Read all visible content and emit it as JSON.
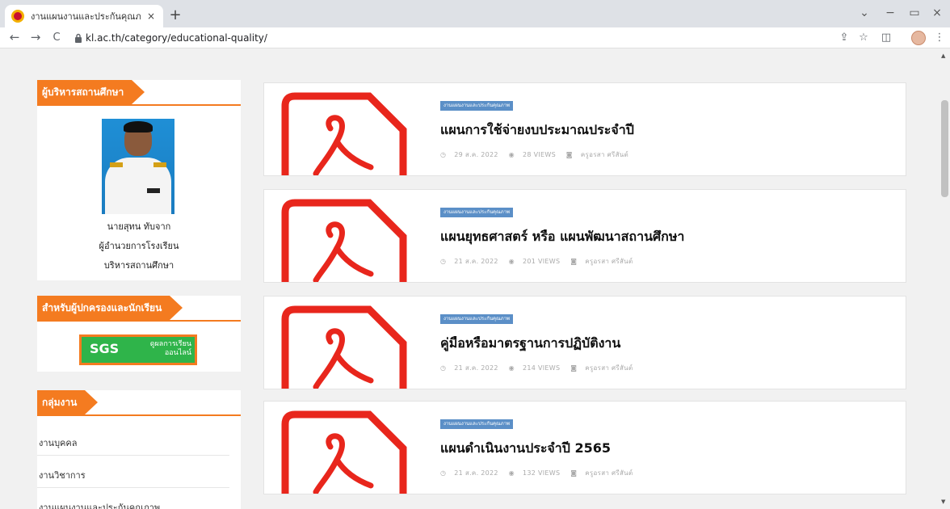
{
  "browser": {
    "tab_title": "งานแผนงานและประกันคุณภาพ – โรงเ",
    "tab_close": "×",
    "new_tab": "+",
    "url": "kl.ac.th/category/educational-quality/",
    "back": "←",
    "forward": "→",
    "reload": "C",
    "share": "⇪",
    "star": "☆",
    "sidepanel": "◫",
    "menu": "⋮",
    "minimize": "−",
    "restore": "▭",
    "close": "×",
    "tabsearch": "⌄"
  },
  "sidebar": {
    "admin_widget": {
      "title": "ผู้บริหารสถานศึกษา",
      "name": "นายสุทน ทับจาก",
      "position": "ผู้อำนวยการโรงเรียน",
      "role": "บริหารสถานศึกษา"
    },
    "parents_widget": {
      "title": "สำหรับผู้ปกครองและนักเรียน",
      "sgs_label": "SGS",
      "sgs_th_line1": "ดูผลการเรียน",
      "sgs_th_line2": "ออนไลน์"
    },
    "groups_widget": {
      "title": "กลุ่มงาน",
      "items": [
        "งานบุคคล",
        "งานวิชาการ",
        "งานแผนงานและประกันคุณภาพ"
      ]
    }
  },
  "posts": [
    {
      "category": "งานแผนงานและประกันคุณภาพ",
      "title": "แผนการใช้จ่ายงบประมาณประจำปี",
      "date": "29 ส.ค. 2022",
      "views": "28 VIEWS",
      "author": "ครูอรสา ศรีสันต์"
    },
    {
      "category": "งานแผนงานและประกันคุณภาพ",
      "title": "แผนยุทธศาสตร์ หรือ แผนพัฒนาสถานศึกษา",
      "date": "21 ส.ค. 2022",
      "views": "201 VIEWS",
      "author": "ครูอรสา ศรีสันต์"
    },
    {
      "category": "งานแผนงานและประกันคุณภาพ",
      "title": "คู่มือหรือมาตรฐานการปฏิบัติงาน",
      "date": "21 ส.ค. 2022",
      "views": "214 VIEWS",
      "author": "ครูอรสา ศรีสันต์"
    },
    {
      "category": "งานแผนงานและประกันคุณภาพ",
      "title": "แผนดำเนินงานประจำปี 2565",
      "date": "21 ส.ค. 2022",
      "views": "132 VIEWS",
      "author": "ครูอรสา ศรีสันต์"
    }
  ],
  "icons": {
    "clock": "◷",
    "eye": "◉",
    "user": "◙"
  },
  "colors": {
    "accent": "#f47b20",
    "category": "#5b8fc7",
    "pdf_red": "#e8261c",
    "sgs_green": "#2fb44a"
  }
}
